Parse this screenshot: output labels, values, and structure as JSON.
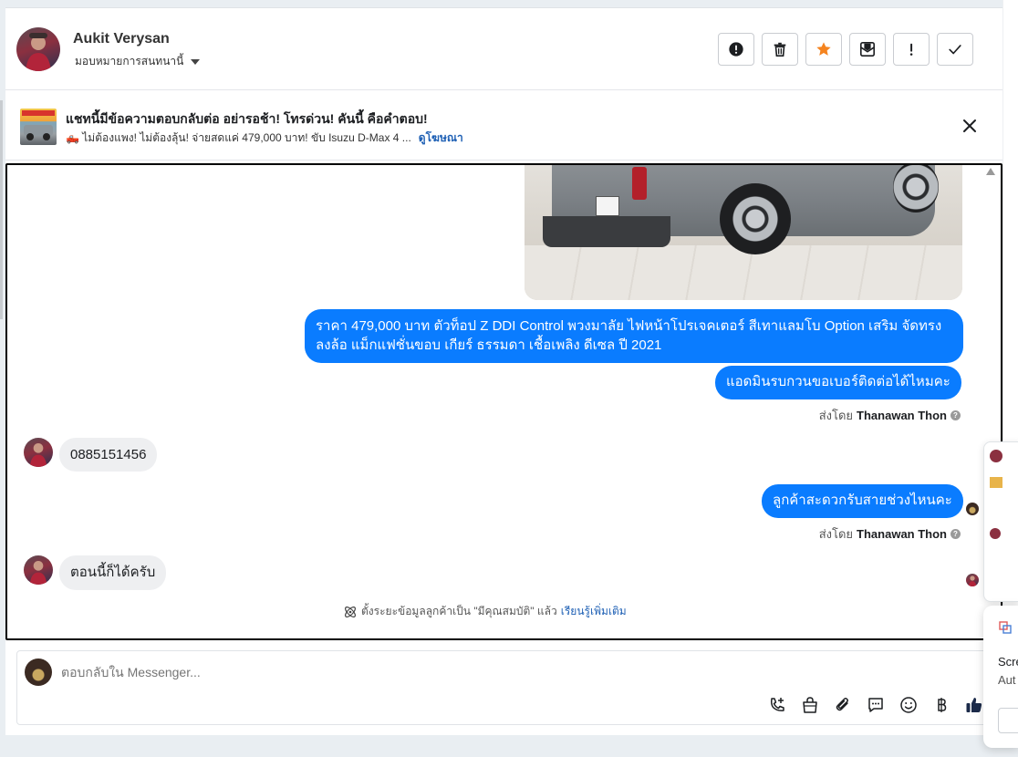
{
  "header": {
    "name": "Aukit Verysan",
    "assign_label": "มอบหมายการสนทนานี้"
  },
  "actions": [
    {
      "name": "report-icon"
    },
    {
      "name": "trash-icon"
    },
    {
      "name": "star-icon",
      "color": "#f5841f"
    },
    {
      "name": "mark-unread-icon"
    },
    {
      "name": "exclamation-icon"
    },
    {
      "name": "check-icon"
    }
  ],
  "ad": {
    "title": "แชทนี้มีข้อความตอบกลับต่อ อย่ารอช้า! โทรด่วน! คันนี้ คือคำตอบ!",
    "subtitle": "🛻 ไม่ต้องแพง! ไม่ต้องลุ้น! จ่ายสดแค่ 479,000 บาท! ขับ Isuzu D-Max 4 ...",
    "link": "ดูโฆษณา"
  },
  "messages": {
    "m1": "ราคา 479,000 บาท  ตัวท็อป Z DDI Control พวงมาลัย ไฟหน้าโปรเจคเตอร์ สีเทาแลมโบ Option เสริม จัดทรงลงล้อ แม็กแฟชั่นขอบ  เกียร์ ธรรมดา  เชื้อเพลิง ดีเซล  ปี 2021",
    "m2": "แอดมินรบกวนขอเบอร์ติดต่อได้ไหมคะ",
    "m3": "0885151456",
    "m4": "ลูกค้าสะดวกรับสายช่วงไหนคะ",
    "m5": "ตอนนี้ก็ได้ครับ"
  },
  "sent_by": {
    "prefix": "ส่งโดย",
    "name": "Thanawan Thon"
  },
  "note": {
    "text": "ตั้งระยะข้อมูลลูกค้าเป็น \"มีคุณสมบัติ\" แล้ว",
    "link": "เรียนรู้เพิ่มเติม"
  },
  "composer": {
    "placeholder": "ตอบกลับใน Messenger..."
  },
  "toolbar": [
    {
      "name": "call-add-icon"
    },
    {
      "name": "shopping-bag-icon"
    },
    {
      "name": "attachment-icon"
    },
    {
      "name": "saved-replies-icon"
    },
    {
      "name": "emoji-icon"
    },
    {
      "name": "baht-icon"
    },
    {
      "name": "thumbs-up-icon",
      "color": "#1c2b4a"
    }
  ],
  "popup": {
    "line1": "Scre",
    "line2": "Aut"
  },
  "colors": {
    "outgoing_bubble": "#0a7cff",
    "incoming_bubble": "#eeeff1",
    "link": "#1d5fb4"
  }
}
